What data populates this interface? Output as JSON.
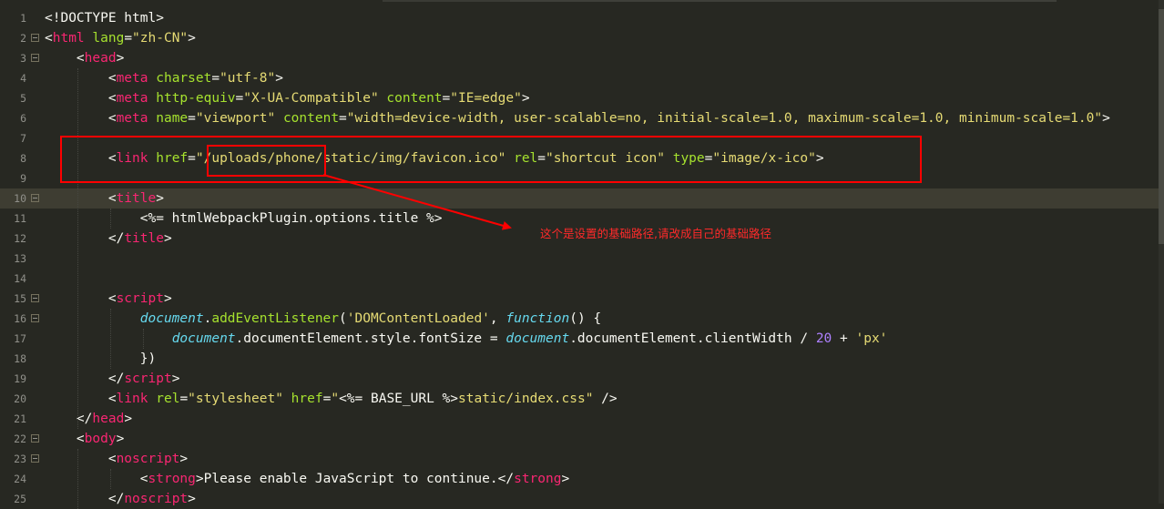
{
  "editor": {
    "lines": [
      {
        "n": "1",
        "segments": [
          {
            "c": "",
            "t": "<!DOCTYPE html>"
          }
        ]
      },
      {
        "n": "2",
        "segments": [
          {
            "c": "",
            "t": "<"
          },
          {
            "c": "tag",
            "t": "html"
          },
          {
            "c": "",
            "t": " "
          },
          {
            "c": "attr",
            "t": "lang"
          },
          {
            "c": "",
            "t": "="
          },
          {
            "c": "str",
            "t": "\"zh-CN\""
          },
          {
            "c": "",
            "t": ">"
          }
        ]
      },
      {
        "n": "3",
        "segments": [
          {
            "c": "",
            "t": "    <"
          },
          {
            "c": "tag",
            "t": "head"
          },
          {
            "c": "",
            "t": ">"
          }
        ]
      },
      {
        "n": "4",
        "segments": [
          {
            "c": "",
            "t": "        <"
          },
          {
            "c": "tag",
            "t": "meta"
          },
          {
            "c": "",
            "t": " "
          },
          {
            "c": "attr",
            "t": "charset"
          },
          {
            "c": "",
            "t": "="
          },
          {
            "c": "str",
            "t": "\"utf-8\""
          },
          {
            "c": "",
            "t": ">"
          }
        ]
      },
      {
        "n": "5",
        "segments": [
          {
            "c": "",
            "t": "        <"
          },
          {
            "c": "tag",
            "t": "meta"
          },
          {
            "c": "",
            "t": " "
          },
          {
            "c": "attr",
            "t": "http-equiv"
          },
          {
            "c": "",
            "t": "="
          },
          {
            "c": "str",
            "t": "\"X-UA-Compatible\""
          },
          {
            "c": "",
            "t": " "
          },
          {
            "c": "attr",
            "t": "content"
          },
          {
            "c": "",
            "t": "="
          },
          {
            "c": "str",
            "t": "\"IE=edge\""
          },
          {
            "c": "",
            "t": ">"
          }
        ]
      },
      {
        "n": "6",
        "segments": [
          {
            "c": "",
            "t": "        <"
          },
          {
            "c": "tag",
            "t": "meta"
          },
          {
            "c": "",
            "t": " "
          },
          {
            "c": "attr",
            "t": "name"
          },
          {
            "c": "",
            "t": "="
          },
          {
            "c": "str",
            "t": "\"viewport\""
          },
          {
            "c": "",
            "t": " "
          },
          {
            "c": "attr",
            "t": "content"
          },
          {
            "c": "",
            "t": "="
          },
          {
            "c": "str",
            "t": "\"width=device-width, user-scalable=no, initial-scale=1.0, maximum-scale=1.0, minimum-scale=1.0\""
          },
          {
            "c": "",
            "t": ">"
          }
        ]
      },
      {
        "n": "7",
        "segments": []
      },
      {
        "n": "8",
        "segments": [
          {
            "c": "",
            "t": "        <"
          },
          {
            "c": "tag",
            "t": "link"
          },
          {
            "c": "",
            "t": " "
          },
          {
            "c": "attr",
            "t": "href"
          },
          {
            "c": "",
            "t": "="
          },
          {
            "c": "str",
            "t": "\"/uploads/phone/static/img/favicon.ico\""
          },
          {
            "c": "",
            "t": " "
          },
          {
            "c": "attr",
            "t": "rel"
          },
          {
            "c": "",
            "t": "="
          },
          {
            "c": "str",
            "t": "\"shortcut icon\""
          },
          {
            "c": "",
            "t": " "
          },
          {
            "c": "attr",
            "t": "type"
          },
          {
            "c": "",
            "t": "="
          },
          {
            "c": "str",
            "t": "\"image/x-ico\""
          },
          {
            "c": "",
            "t": ">"
          }
        ]
      },
      {
        "n": "9",
        "segments": []
      },
      {
        "n": "10",
        "segments": [
          {
            "c": "",
            "t": "        <"
          },
          {
            "c": "tag",
            "t": "title"
          },
          {
            "c": "",
            "t": ">"
          }
        ]
      },
      {
        "n": "11",
        "segments": [
          {
            "c": "",
            "t": "            <%= htmlWebpackPlugin.options.title %>"
          }
        ]
      },
      {
        "n": "12",
        "segments": [
          {
            "c": "",
            "t": "        </"
          },
          {
            "c": "tag",
            "t": "title"
          },
          {
            "c": "",
            "t": ">"
          }
        ]
      },
      {
        "n": "13",
        "segments": []
      },
      {
        "n": "14",
        "segments": []
      },
      {
        "n": "15",
        "segments": [
          {
            "c": "",
            "t": "        <"
          },
          {
            "c": "tag",
            "t": "script"
          },
          {
            "c": "",
            "t": ">"
          }
        ]
      },
      {
        "n": "16",
        "segments": [
          {
            "c": "",
            "t": "            "
          },
          {
            "c": "js",
            "t": "document"
          },
          {
            "c": "",
            "t": "."
          },
          {
            "c": "attr",
            "t": "addEventListener"
          },
          {
            "c": "",
            "t": "("
          },
          {
            "c": "str",
            "t": "'DOMContentLoaded'"
          },
          {
            "c": "",
            "t": ", "
          },
          {
            "c": "js",
            "t": "function"
          },
          {
            "c": "",
            "t": "() {"
          }
        ]
      },
      {
        "n": "17",
        "segments": [
          {
            "c": "",
            "t": "                "
          },
          {
            "c": "js",
            "t": "document"
          },
          {
            "c": "",
            "t": ".documentElement.style.fontSize = "
          },
          {
            "c": "js",
            "t": "document"
          },
          {
            "c": "",
            "t": ".documentElement.clientWidth / "
          },
          {
            "c": "num",
            "t": "20"
          },
          {
            "c": "",
            "t": " + "
          },
          {
            "c": "str",
            "t": "'px'"
          }
        ]
      },
      {
        "n": "18",
        "segments": [
          {
            "c": "",
            "t": "            })"
          }
        ]
      },
      {
        "n": "19",
        "segments": [
          {
            "c": "",
            "t": "        </"
          },
          {
            "c": "tag",
            "t": "script"
          },
          {
            "c": "",
            "t": ">"
          }
        ]
      },
      {
        "n": "20",
        "segments": [
          {
            "c": "",
            "t": "        <"
          },
          {
            "c": "tag",
            "t": "link"
          },
          {
            "c": "",
            "t": " "
          },
          {
            "c": "attr",
            "t": "rel"
          },
          {
            "c": "",
            "t": "="
          },
          {
            "c": "str",
            "t": "\"stylesheet\""
          },
          {
            "c": "",
            "t": " "
          },
          {
            "c": "attr",
            "t": "href"
          },
          {
            "c": "",
            "t": "="
          },
          {
            "c": "str",
            "t": "\""
          },
          {
            "c": "",
            "t": "<%= BASE_URL %>"
          },
          {
            "c": "str",
            "t": "static/index.css\""
          },
          {
            "c": "",
            "t": " />"
          }
        ]
      },
      {
        "n": "21",
        "segments": [
          {
            "c": "",
            "t": "    </"
          },
          {
            "c": "tag",
            "t": "head"
          },
          {
            "c": "",
            "t": ">"
          }
        ]
      },
      {
        "n": "22",
        "segments": [
          {
            "c": "",
            "t": "    <"
          },
          {
            "c": "tag",
            "t": "body"
          },
          {
            "c": "",
            "t": ">"
          }
        ]
      },
      {
        "n": "23",
        "segments": [
          {
            "c": "",
            "t": "        <"
          },
          {
            "c": "tag",
            "t": "noscript"
          },
          {
            "c": "",
            "t": ">"
          }
        ]
      },
      {
        "n": "24",
        "segments": [
          {
            "c": "",
            "t": "            <"
          },
          {
            "c": "tag",
            "t": "strong"
          },
          {
            "c": "",
            "t": ">Please enable JavaScript to continue.</"
          },
          {
            "c": "tag",
            "t": "strong"
          },
          {
            "c": "",
            "t": ">"
          }
        ]
      },
      {
        "n": "25",
        "segments": [
          {
            "c": "",
            "t": "        </"
          },
          {
            "c": "tag",
            "t": "noscript"
          },
          {
            "c": "",
            "t": ">"
          }
        ]
      }
    ],
    "folds": [
      "2",
      "3",
      "10",
      "15",
      "16",
      "22",
      "23"
    ],
    "active_line": "10"
  },
  "annotation": {
    "text": "这个是设置的基础路径,请改成自己的基础路径",
    "color": "#ff0000"
  }
}
